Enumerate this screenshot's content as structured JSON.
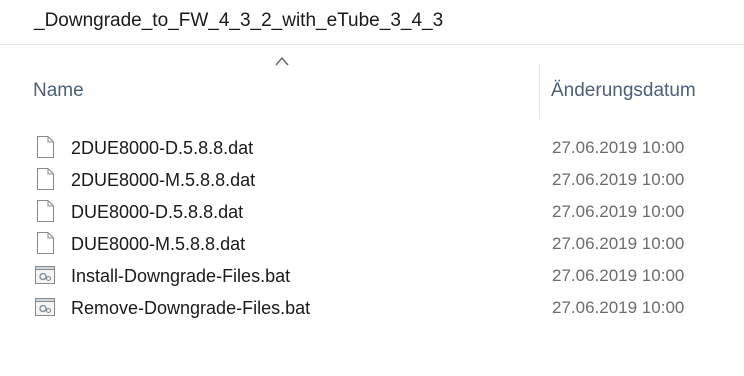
{
  "breadcrumb": {
    "folder": "_Downgrade_to_FW_4_3_2_with_eTube_3_4_3"
  },
  "columns": {
    "name": "Name",
    "modified": "Änderungsdatum"
  },
  "files": [
    {
      "name": "2DUE8000-D.5.8.8.dat",
      "modified": "27.06.2019 10:00",
      "icon": "file-icon"
    },
    {
      "name": "2DUE8000-M.5.8.8.dat",
      "modified": "27.06.2019 10:00",
      "icon": "file-icon"
    },
    {
      "name": "DUE8000-D.5.8.8.dat",
      "modified": "27.06.2019 10:00",
      "icon": "file-icon"
    },
    {
      "name": "DUE8000-M.5.8.8.dat",
      "modified": "27.06.2019 10:00",
      "icon": "file-icon"
    },
    {
      "name": "Install-Downgrade-Files.bat",
      "modified": "27.06.2019 10:00",
      "icon": "batch-file-icon"
    },
    {
      "name": "Remove-Downgrade-Files.bat",
      "modified": "27.06.2019 10:00",
      "icon": "batch-file-icon"
    }
  ]
}
